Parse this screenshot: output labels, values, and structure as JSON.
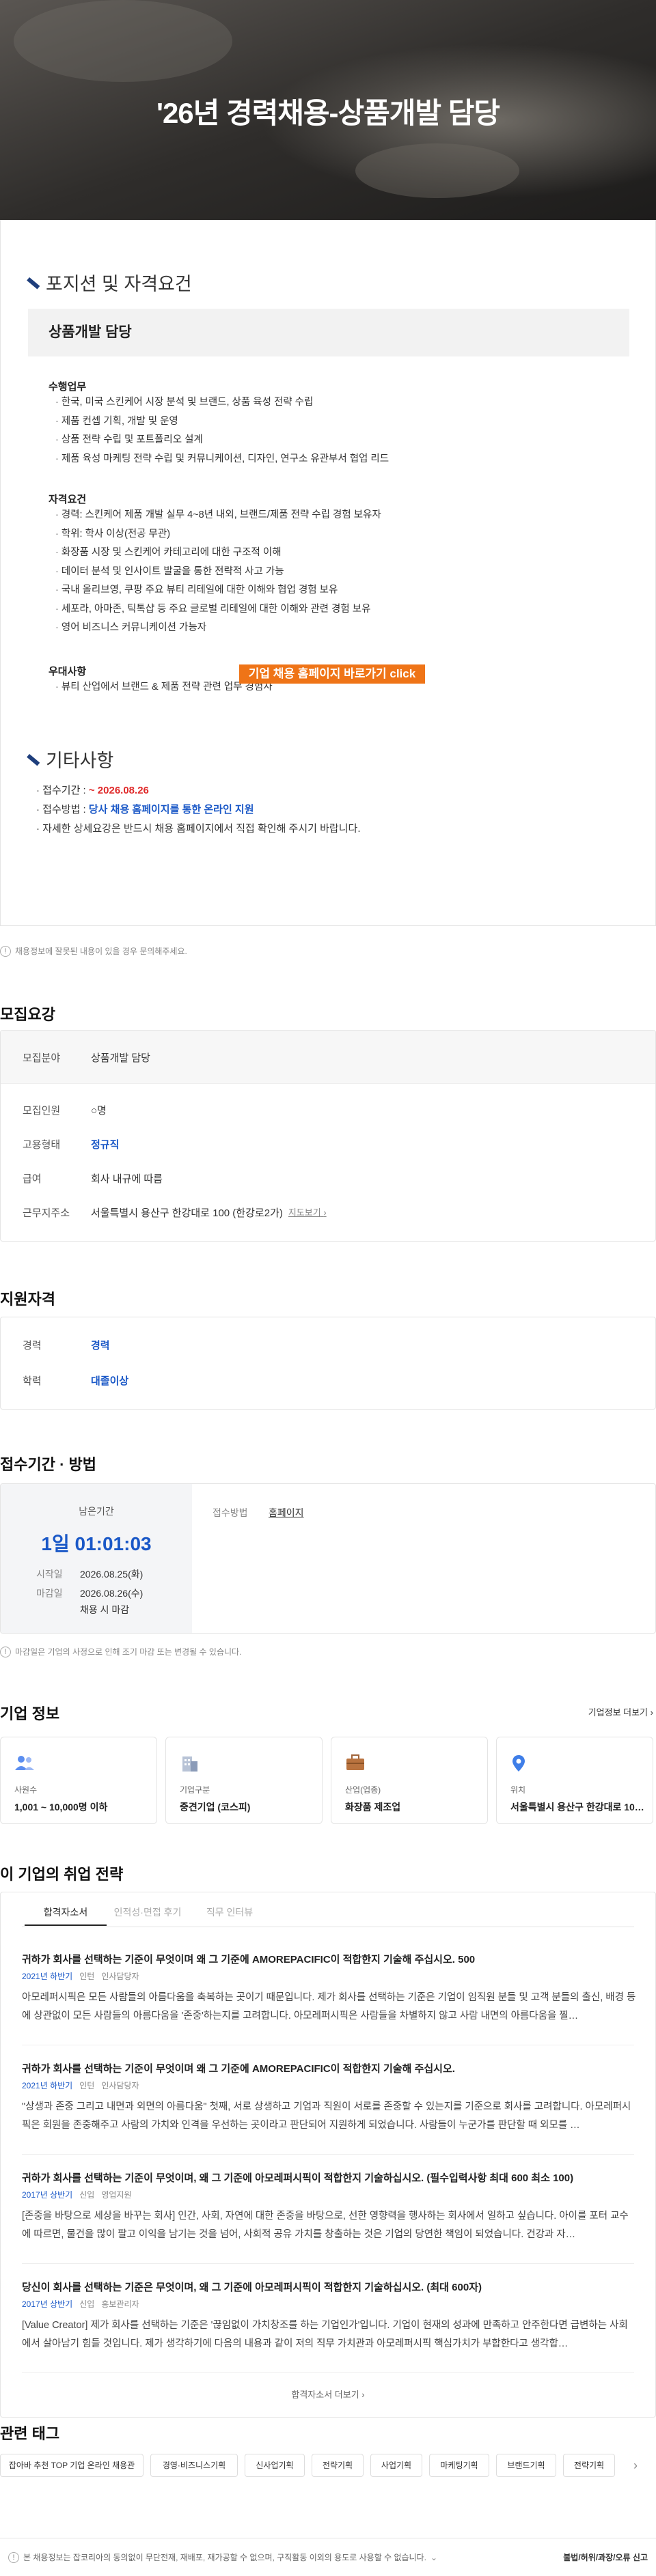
{
  "hero": {
    "title": "'26년 경력채용-상품개발 담당"
  },
  "posting": {
    "section1_title": "포지션 및 자격요건",
    "position_name": "상품개발 담당",
    "duties_title": "수행업무",
    "duties": [
      "한국, 미국 스킨케어 시장 분석 및 브랜드, 상품 육성 전략 수립",
      "제품 컨셉 기획, 개발 및 운영",
      "상품 전략 수립 및 포트폴리오 설계",
      "제품 육성 마케팅 전략 수립 및 커뮤니케이션, 디자인, 연구소 유관부서 협업 리드"
    ],
    "quals_title": "자격요건",
    "quals": [
      "경력: 스킨케어 제품 개발 실무 4~8년 내외, 브랜드/제품 전략 수립 경험 보유자",
      "학위: 학사 이상(전공 무관)",
      "화장품 시장 및 스킨케어 카테고리에 대한 구조적 이해",
      "데이터 분석 및 인사이트 발굴을 통한 전략적 사고 가능",
      "국내 올리브영, 쿠팡 주요 뷰티 리테일에 대한 이해와 협업 경험 보유",
      "세포라, 아마존, 틱톡샵 등 주요 글로벌 리테일에 대한 이해와 관련 경험 보유",
      "영어 비즈니스 커뮤니케이션 가능자"
    ],
    "pref_title": "우대사항",
    "prefs": [
      "뷰티 산업에서 브랜드 & 제품 전략 관련 업무 경험자"
    ],
    "section2_title": "기타사항",
    "period_label": "접수기간 : ",
    "period_value": "~ 2026.08.26",
    "method_label": "접수방법 : ",
    "method_value": "당사 채용 홈페이지를 통한 온라인 지원",
    "detail_note": "자세한 상세요강은 반드시 채용 홈페이지에서 직접 확인해 주시기 바랍니다.",
    "cta_label": "기업 채용 홈페이지 바로가기 click",
    "footnote": "채용정보에 잘못된 내용이 있을 경우 문의해주세요."
  },
  "recruit": {
    "title": "모집요강",
    "field_label": "모집분야",
    "field_value": "상품개발 담당",
    "count_label": "모집인원",
    "count_value": "○명",
    "type_label": "고용형태",
    "type_value": "정규직",
    "pay_label": "급여",
    "pay_value": "회사 내규에 따름",
    "addr_label": "근무지주소",
    "addr_value": "서울특별시 용산구 한강대로 100 (한강로2가)",
    "map_label": "지도보기"
  },
  "qualification": {
    "title": "지원자격",
    "career_label": "경력",
    "career_value": "경력",
    "edu_label": "학력",
    "edu_value": "대졸이상"
  },
  "deadline": {
    "title": "접수기간 · 방법",
    "remain_label": "남은기간",
    "remain_value": "1일 01:01:03",
    "start_label": "시작일",
    "start_value": "2026.08.25(화)",
    "end_label": "마감일",
    "end_value": "2026.08.26(수)",
    "end_note": "채용 시 마감",
    "method_label": "접수방법",
    "method_value": "홈페이지",
    "footnote": "마감일은 기업의 사정으로 인해 조기 마감 또는 변경될 수 있습니다."
  },
  "company": {
    "title": "기업 정보",
    "more_label": "기업정보 더보기",
    "cards": [
      {
        "icon": "people-icon",
        "label": "사원수",
        "value": "1,001 ~ 10,000명 이하"
      },
      {
        "icon": "building-icon",
        "label": "기업구분",
        "value": "중견기업 (코스피)"
      },
      {
        "icon": "briefcase-icon",
        "label": "산업(업종)",
        "value": "화장품 제조업"
      },
      {
        "icon": "location-pin-icon",
        "label": "위치",
        "value": "서울특별시 용산구 한강대로 10…"
      }
    ]
  },
  "strategy": {
    "title": "이 기업의 취업 전략",
    "tabs": [
      "합격자소서",
      "인적성·면접 후기",
      "직무 인터뷰"
    ],
    "items": [
      {
        "title": "귀하가 회사를 선택하는 기준이 무엇이며 왜 그 기준에 AMOREPACIFIC이 적합한지 기술해 주십시오. 500",
        "year": "2021년 하반기",
        "level": "인턴",
        "dept": "인사담당자",
        "body": "아모레퍼시픽은 모든 사람들의 아름다움을 축복하는 곳이기 때문입니다. 제가 회사를 선택하는 기준은 기업이 임직원 분들 및 고객 분들의 출신, 배경 등에 상관없이 모든 사람들의 아름다움을 '존중'하는지를 고려합니다. 아모레퍼시픽은 사람들을 차별하지 않고 사람 내면의 아름다움을 찔…"
      },
      {
        "title": "귀하가 회사를 선택하는 기준이 무엇이며 왜 그 기준에 AMOREPACIFIC이 적합한지 기술해 주십시오.",
        "year": "2021년 하반기",
        "level": "인턴",
        "dept": "인사담당자",
        "body": "\"상생과 존중 그리고 내면과 외면의 아름다움\" 첫째, 서로 상생하고 기업과 직원이 서로를 존중할 수 있는지를 기준으로 회사를 고려합니다. 아모레퍼시픽은 회원을 존중해주고 사람의 가치와 인격을 우선하는 곳이라고 판단되어 지원하게 되었습니다. 사람들이 누군가를 판단할 때 외모를 …"
      },
      {
        "title": "귀하가 회사를 선택하는 기준이 무엇이며, 왜 그 기준에 아모레퍼시픽이 적합한지 기술하십시오. (필수입력사항 최대 600 최소 100)",
        "year": "2017년 상반기",
        "level": "신입",
        "dept": "영업지원",
        "body": "[존중을 바탕으로 세상을 바꾸는 회사] 인간, 사회, 자연에 대한 존중을 바탕으로, 선한 영향력을 행사하는 회사에서 일하고 싶습니다. 아이를 포터 교수에 따르면, 물건을 많이 팔고 이익을 남기는 것을 넘어, 사회적 공유 가치를 창출하는 것은 기업의 당연한 책임이 되었습니다. 건강과 자…"
      },
      {
        "title": "당신이 회사를 선택하는 기준은 무엇이며, 왜 그 기준에 아모레퍼시픽이 적합한지 기술하십시오. (최대 600자)",
        "year": "2017년 상반기",
        "level": "신입",
        "dept": "홍보관리자",
        "body": "[Value Creator] 제가 회사를 선택하는 기준은 '끊임없이 가치창조를 하는 기업인가'입니다. 기업이 현재의 성과에 만족하고 안주한다면 급변하는 사회에서 살아남기 힘들 것입니다. 제가 생각하기에 다음의 내용과 같이 저의 직무 가치관과 아모레퍼시픽 핵심가치가 부합한다고 생각합…"
      }
    ],
    "more_label": "합격자소서 더보기"
  },
  "tags": {
    "title": "관련 태그",
    "items": [
      "잡아바 추천 TOP 기업 온라인 채용관",
      "경영·비즈니스기획",
      "신사업기획",
      "전략기획",
      "사업기획",
      "마케팅기획",
      "브랜드기획",
      "전략기획"
    ]
  },
  "footer": {
    "notice": "본 채용정보는 잡코리아의 동의없이 무단전재, 재배포, 재가공할 수 없으며, 구직활동 이외의 용도로 사용할 수 없습니다.",
    "report_label": "불법/허위/과장/오류 신고"
  }
}
